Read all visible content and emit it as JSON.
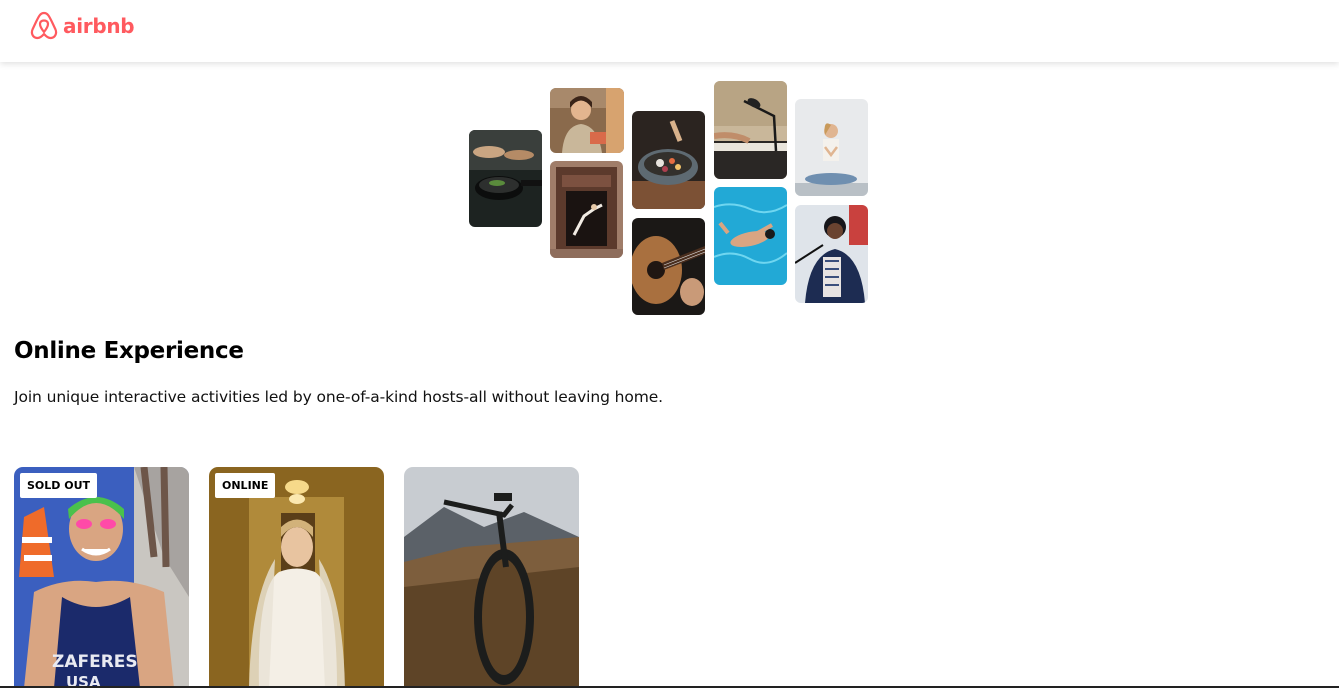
{
  "navbar": {
    "logo_text": "airbnb",
    "brand_color": "#ff5a5f"
  },
  "hero": {
    "tiles": [
      {
        "name": "cooking-photo",
        "icon": "cooking-pan"
      },
      {
        "name": "host-portrait-photo",
        "icon": "person"
      },
      {
        "name": "dancer-doorway-photo",
        "icon": "dancer"
      },
      {
        "name": "food-bowl-photo",
        "icon": "bowl"
      },
      {
        "name": "guitar-photo",
        "icon": "guitar"
      },
      {
        "name": "piano-microphone-photo",
        "icon": "microphone"
      },
      {
        "name": "swimmer-photo",
        "icon": "swimmer"
      },
      {
        "name": "yoga-photo",
        "icon": "yoga"
      },
      {
        "name": "singer-photo",
        "icon": "singer"
      }
    ]
  },
  "section": {
    "title": "Online Experience",
    "subtitle": "Join unique interactive activities led by one-of-a-kind hosts-all without leaving home."
  },
  "cards": [
    {
      "badge": "SOLD OUT",
      "image": "athlete-swimmer"
    },
    {
      "badge": "ONLINE",
      "image": "bride"
    },
    {
      "badge": "",
      "image": "mountain-bike"
    }
  ]
}
